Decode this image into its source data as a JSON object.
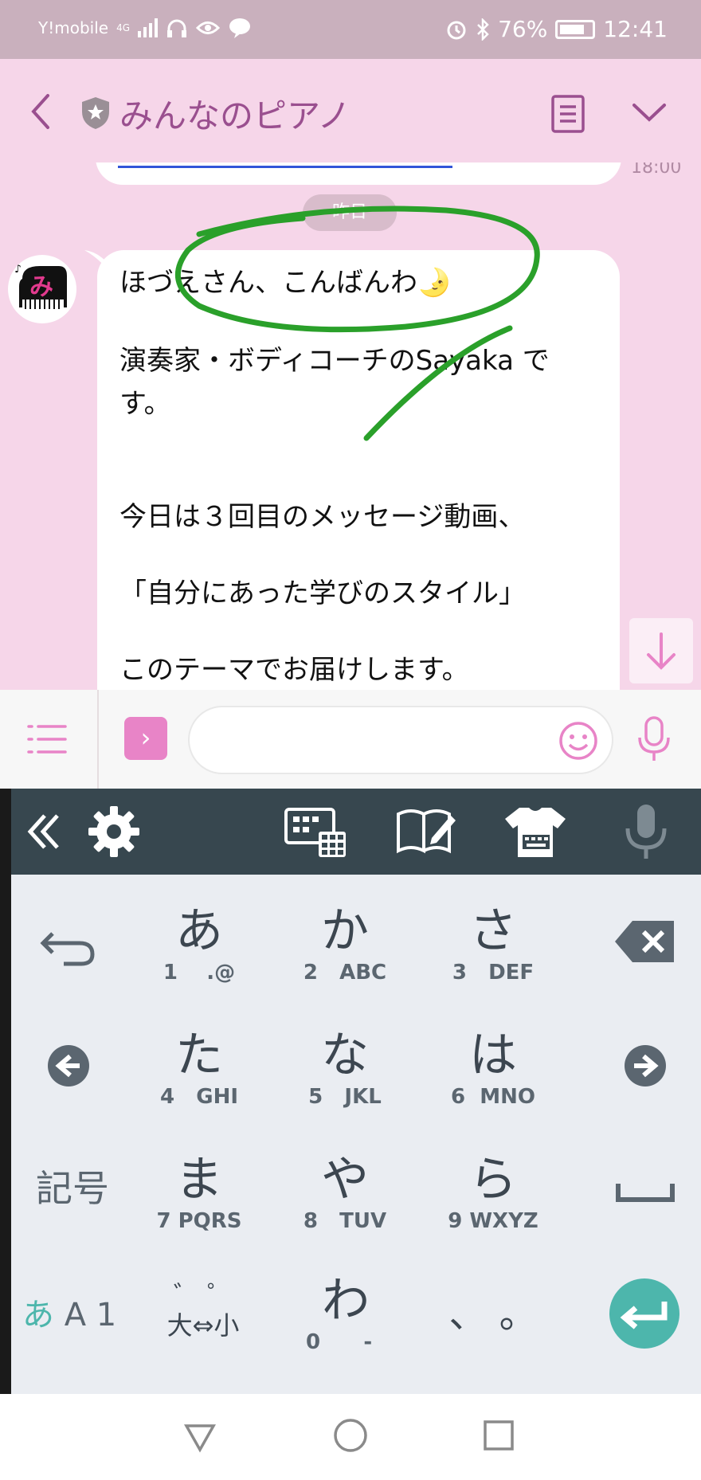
{
  "status_bar": {
    "carrier": "Y!mobile",
    "network": "4G",
    "battery": "76%",
    "time": "12:41",
    "icons": [
      "signal-icon",
      "headphones-icon",
      "eye-icon",
      "line-icon",
      "alarm-icon",
      "bluetooth-icon",
      "battery-icon"
    ]
  },
  "header": {
    "title": "みんなのピアノ",
    "icons": [
      "back-icon",
      "shield-icon",
      "notes-icon",
      "chevron-down-icon"
    ]
  },
  "chat": {
    "prev_time": "18:00",
    "date_divider": "昨日",
    "message_lines": [
      "ほづえさん、こんばんわ🌛",
      "演奏家・ボディコーチのSayaka で",
      "す。",
      "今日は３回目のメッセージ動画、",
      "「自分にあった学びのスタイル」",
      "このテーマでお届けします。"
    ]
  },
  "input_bar": {
    "placeholder": "",
    "icons": [
      "menu-icon",
      "expand-icon",
      "emoji-icon",
      "mic-icon"
    ]
  },
  "keyboard": {
    "toolbar_icons": [
      "collapse-icon",
      "gear-icon",
      "keypad-icon",
      "dictionary-icon",
      "theme-icon",
      "mic-icon"
    ],
    "rows": [
      [
        {
          "kana": "あ",
          "num": "1",
          "sub": ".@"
        },
        {
          "kana": "か",
          "num": "2",
          "sub": "ABC"
        },
        {
          "kana": "さ",
          "num": "3",
          "sub": "DEF"
        }
      ],
      [
        {
          "kana": "た",
          "num": "4",
          "sub": "GHI"
        },
        {
          "kana": "な",
          "num": "5",
          "sub": "JKL"
        },
        {
          "kana": "は",
          "num": "6",
          "sub": "MNO"
        }
      ],
      [
        {
          "kana": "ま",
          "num": "7",
          "sub": "PQRS"
        },
        {
          "kana": "や",
          "num": "8",
          "sub": "TUV"
        },
        {
          "kana": "ら",
          "num": "9",
          "sub": "WXYZ"
        }
      ]
    ],
    "dakuten": "゛ ゜",
    "size_toggle": "大⇔小",
    "wa": "わ",
    "wa_num": "0",
    "wa_sub": "-",
    "punct": "、 。",
    "symbols": "記号",
    "mode_kana": "あ",
    "mode_rest": "A 1"
  },
  "colors": {
    "accent": "#9a4f8f",
    "chat_bg": "#f6d6e9",
    "toolbar": "#37474f",
    "enter": "#4db6ac",
    "annotation": "#2aa02a"
  }
}
